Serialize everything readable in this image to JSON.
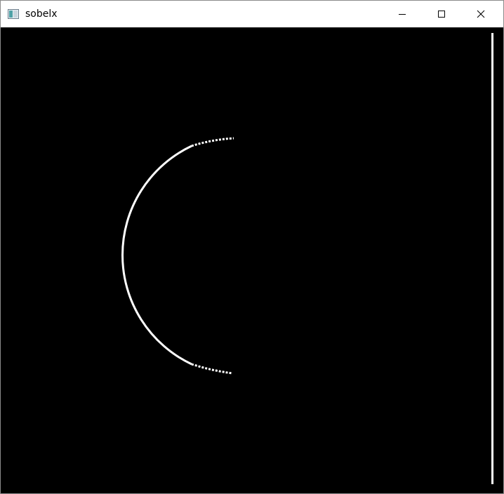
{
  "window": {
    "title": "sobelx",
    "icon": "opencv-window-icon",
    "controls": [
      "minimize-icon",
      "maximize-icon",
      "close-icon"
    ]
  },
  "image": {
    "description_colors": {
      "background": "#000000",
      "edges": "#ffffff"
    }
  }
}
